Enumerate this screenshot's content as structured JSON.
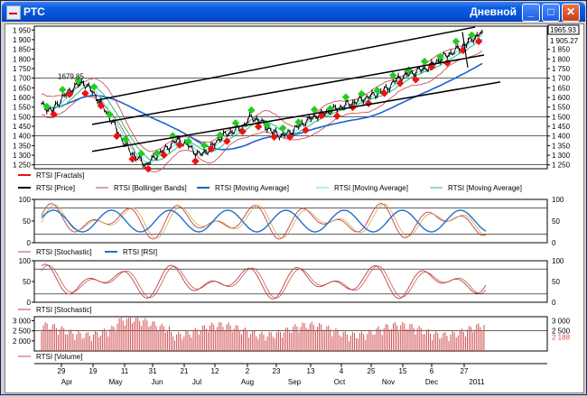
{
  "window": {
    "title": "РТС",
    "mode": "Дневной"
  },
  "colors": {
    "fractal_up": "#22cc22",
    "fractal_down": "#ee1111",
    "price": "#000000",
    "bollinger": "#c04040",
    "ma_long": "#1f5fd0",
    "ma_short": "#60e0e0",
    "ma_mid": "#20c070",
    "stochastic": "#c04040",
    "rsi": "#1f6fd0",
    "volume": "#d05050",
    "channel": "#000000"
  },
  "price_panel": {
    "y_ticks": [
      "1 950",
      "1 900",
      "1 850",
      "1 800",
      "1 750",
      "1 700",
      "1 650",
      "1 600",
      "1 550",
      "1 500",
      "1 450",
      "1 400",
      "1 350",
      "1 300",
      "1 250"
    ],
    "right_ticks": [
      "1 850",
      "1 800",
      "1 750",
      "1 700",
      "1 650",
      "1 600",
      "1 550",
      "1 500",
      "1 450",
      "1 400",
      "1 350",
      "1 300",
      "1 250"
    ],
    "last_price": "1965.93",
    "second_price": "1 905.27",
    "peak_label": "1679.85",
    "legend": [
      {
        "label": "RTSI [Fractals]"
      },
      {
        "label": "RTSI [Price]"
      },
      {
        "label": "RTSI [Bollinger Bands]"
      },
      {
        "label": "RTSI [Moving Average]"
      },
      {
        "label": "RTSI [Moving Average]"
      },
      {
        "label": "RTSI [Moving Average]"
      }
    ]
  },
  "osc_panel_1": {
    "y_ticks": [
      "100",
      "50",
      "0"
    ],
    "legend": [
      {
        "label": "RTSI [Stochastic]"
      },
      {
        "label": "RTSI [RSI]"
      }
    ]
  },
  "osc_panel_2": {
    "y_ticks": [
      "100",
      "50",
      "0"
    ],
    "legend": [
      {
        "label": "RTSI [Stochastic]"
      }
    ]
  },
  "volume_panel": {
    "y_ticks": [
      "3 000",
      "2 500",
      "2 000"
    ],
    "right_ticks": [
      "3 000",
      "2 500"
    ],
    "last_volume": "2 188",
    "legend": [
      {
        "label": "RTSI [Volume]"
      }
    ]
  },
  "x_axis": {
    "days": [
      "29",
      "19",
      "11",
      "31",
      "21",
      "12",
      "2",
      "23",
      "13",
      "4",
      "25",
      "15",
      "6",
      "27"
    ],
    "months": [
      "Apr",
      "May",
      "Jun",
      "Jul",
      "Aug",
      "Sep",
      "Oct",
      "Nov",
      "Dec",
      "2011"
    ]
  },
  "chart_data": {
    "type": "line",
    "series": [
      {
        "name": "RTSI [Price]",
        "values": [
          1560,
          1530,
          1600,
          1650,
          1680,
          1620,
          1540,
          1450,
          1350,
          1290,
          1250,
          1300,
          1340,
          1380,
          1350,
          1300,
          1330,
          1390,
          1420,
          1440,
          1500,
          1470,
          1420,
          1400,
          1430,
          1470,
          1500,
          1520,
          1540,
          1560,
          1580,
          1600,
          1620,
          1650,
          1700,
          1720,
          1740,
          1760,
          1800,
          1830,
          1860,
          1900,
          1940
        ]
      }
    ],
    "ylim": [
      1230,
      1970
    ],
    "oscillator_ylim": [
      0,
      100
    ],
    "volume_ylim": [
      1500,
      3000
    ]
  }
}
